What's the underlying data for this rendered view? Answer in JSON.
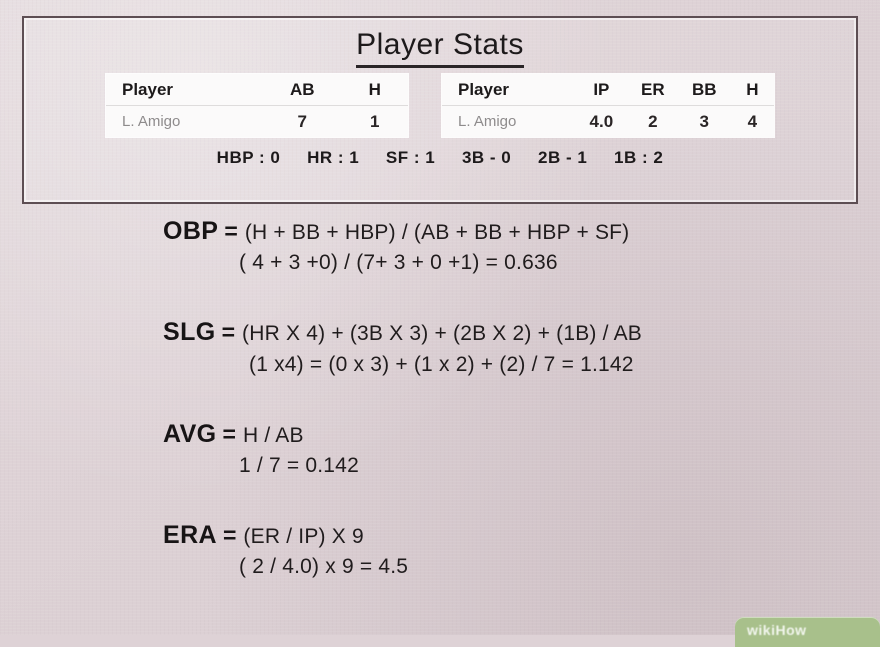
{
  "panel": {
    "title": "Player Stats",
    "batting_table": {
      "headers": [
        "Player",
        "AB",
        "H"
      ],
      "rows": [
        {
          "player": "L. Amigo",
          "AB": "7",
          "H": "1"
        }
      ]
    },
    "pitching_table": {
      "headers": [
        "Player",
        "IP",
        "ER",
        "BB",
        "H"
      ],
      "rows": [
        {
          "player": "L. Amigo",
          "IP": "4.0",
          "ER": "2",
          "BB": "3",
          "H": "4"
        }
      ]
    },
    "extra_stats": [
      "HBP : 0",
      "HR : 1",
      "SF : 1",
      "3B - 0",
      "2B - 1",
      "1B : 2"
    ]
  },
  "formulas": [
    {
      "label": "OBP",
      "eq": "=",
      "expr": "(H + BB  + HBP) / (AB + BB + HBP + SF)",
      "work": "( 4 + 3 +0) / (7+ 3 + 0 +1) = 0.636"
    },
    {
      "label": "SLG",
      "eq": "=",
      "expr": "(HR X 4) + (3B X 3) + (2B X 2) + (1B) / AB",
      "work": "(1 x4) = (0 x 3) + (1 x 2) + (2) / 7  = 1.142"
    },
    {
      "label": "AVG",
      "eq": "=",
      "expr": "H / AB",
      "work": "1 / 7 = 0.142"
    },
    {
      "label": "ERA",
      "eq": "=",
      "expr": "(ER / IP) X 9",
      "work": "( 2 / 4.0) x 9 = 4.5"
    }
  ],
  "watermark": {
    "text": "wikiHow"
  },
  "colors": {
    "background": "#ded2d6",
    "panel_border": "#5d4e53",
    "table_background": "#fbfafa",
    "player_name": "#8e8b8c",
    "text": "#1d1a1b",
    "watermark_green": "#a8c08b"
  }
}
